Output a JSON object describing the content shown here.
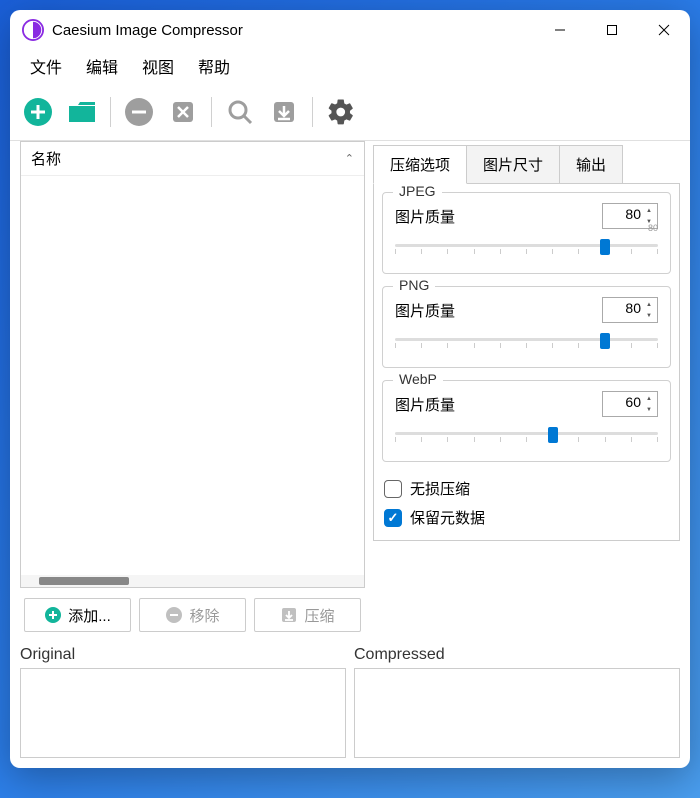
{
  "window": {
    "title": "Caesium Image Compressor"
  },
  "menu": {
    "file": "文件",
    "edit": "编辑",
    "view": "视图",
    "help": "帮助"
  },
  "list": {
    "column_name": "名称"
  },
  "actions": {
    "add": "添加...",
    "remove": "移除",
    "compress": "压缩"
  },
  "tabs": {
    "compress": "压缩选项",
    "size": "图片尺寸",
    "output": "输出"
  },
  "groups": {
    "jpeg": {
      "title": "JPEG",
      "quality_label": "图片质量",
      "quality_value": "80",
      "slider_pct": 80
    },
    "png": {
      "title": "PNG",
      "quality_label": "图片质量",
      "quality_value": "80",
      "slider_pct": 80
    },
    "webp": {
      "title": "WebP",
      "quality_label": "图片质量",
      "quality_value": "60",
      "slider_pct": 60
    }
  },
  "options": {
    "lossless": "无损压缩",
    "keep_metadata": "保留元数据"
  },
  "preview": {
    "original": "Original",
    "compressed": "Compressed"
  },
  "colors": {
    "accent": "#12b59b",
    "disabled": "#9e9e9e",
    "blue": "#0078d4"
  }
}
